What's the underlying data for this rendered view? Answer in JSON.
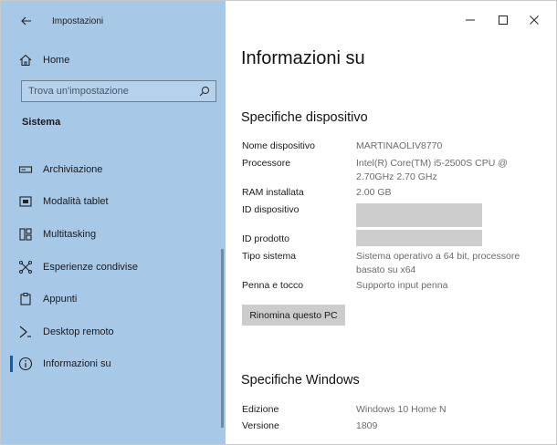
{
  "window": {
    "app_title": "Impostazioni",
    "controls": {
      "minimize": "minimize-icon",
      "maximize": "maximize-icon",
      "close": "close-icon"
    }
  },
  "sidebar": {
    "home_label": "Home",
    "search_placeholder": "Trova un'impostazione",
    "section_heading": "Sistema",
    "items": [
      {
        "label": "Archiviazione",
        "icon": "storage-icon"
      },
      {
        "label": "Modalità tablet",
        "icon": "tablet-mode-icon"
      },
      {
        "label": "Multitasking",
        "icon": "multitasking-icon"
      },
      {
        "label": "Esperienze condivise",
        "icon": "shared-experiences-icon"
      },
      {
        "label": "Appunti",
        "icon": "clipboard-icon"
      },
      {
        "label": "Desktop remoto",
        "icon": "remote-desktop-icon"
      },
      {
        "label": "Informazioni su",
        "icon": "info-icon",
        "selected": true
      }
    ]
  },
  "main": {
    "page_title": "Informazioni su",
    "device_specs": {
      "heading": "Specifiche dispositivo",
      "rows": [
        {
          "label": "Nome dispositivo",
          "value": "MARTINAOLIV8770"
        },
        {
          "label": "Processore",
          "value_line1": "Intel(R) Core(TM) i5-2500S CPU @",
          "value_line2": "2.70GHz   2.70 GHz"
        },
        {
          "label": "RAM installata",
          "value": "2.00 GB"
        },
        {
          "label": "ID dispositivo",
          "value": ""
        },
        {
          "label": "ID prodotto",
          "value": ""
        },
        {
          "label": "Tipo sistema",
          "value_line1": "Sistema operativo a 64 bit, processore",
          "value_line2": "basato su x64"
        },
        {
          "label": "Penna e tocco",
          "value": "Supporto input penna"
        }
      ],
      "rename_button": "Rinomina questo PC"
    },
    "windows_specs": {
      "heading": "Specifiche Windows",
      "rows": [
        {
          "label": "Edizione",
          "value": "Windows 10 Home N"
        },
        {
          "label": "Versione",
          "value": "1809"
        }
      ]
    }
  }
}
